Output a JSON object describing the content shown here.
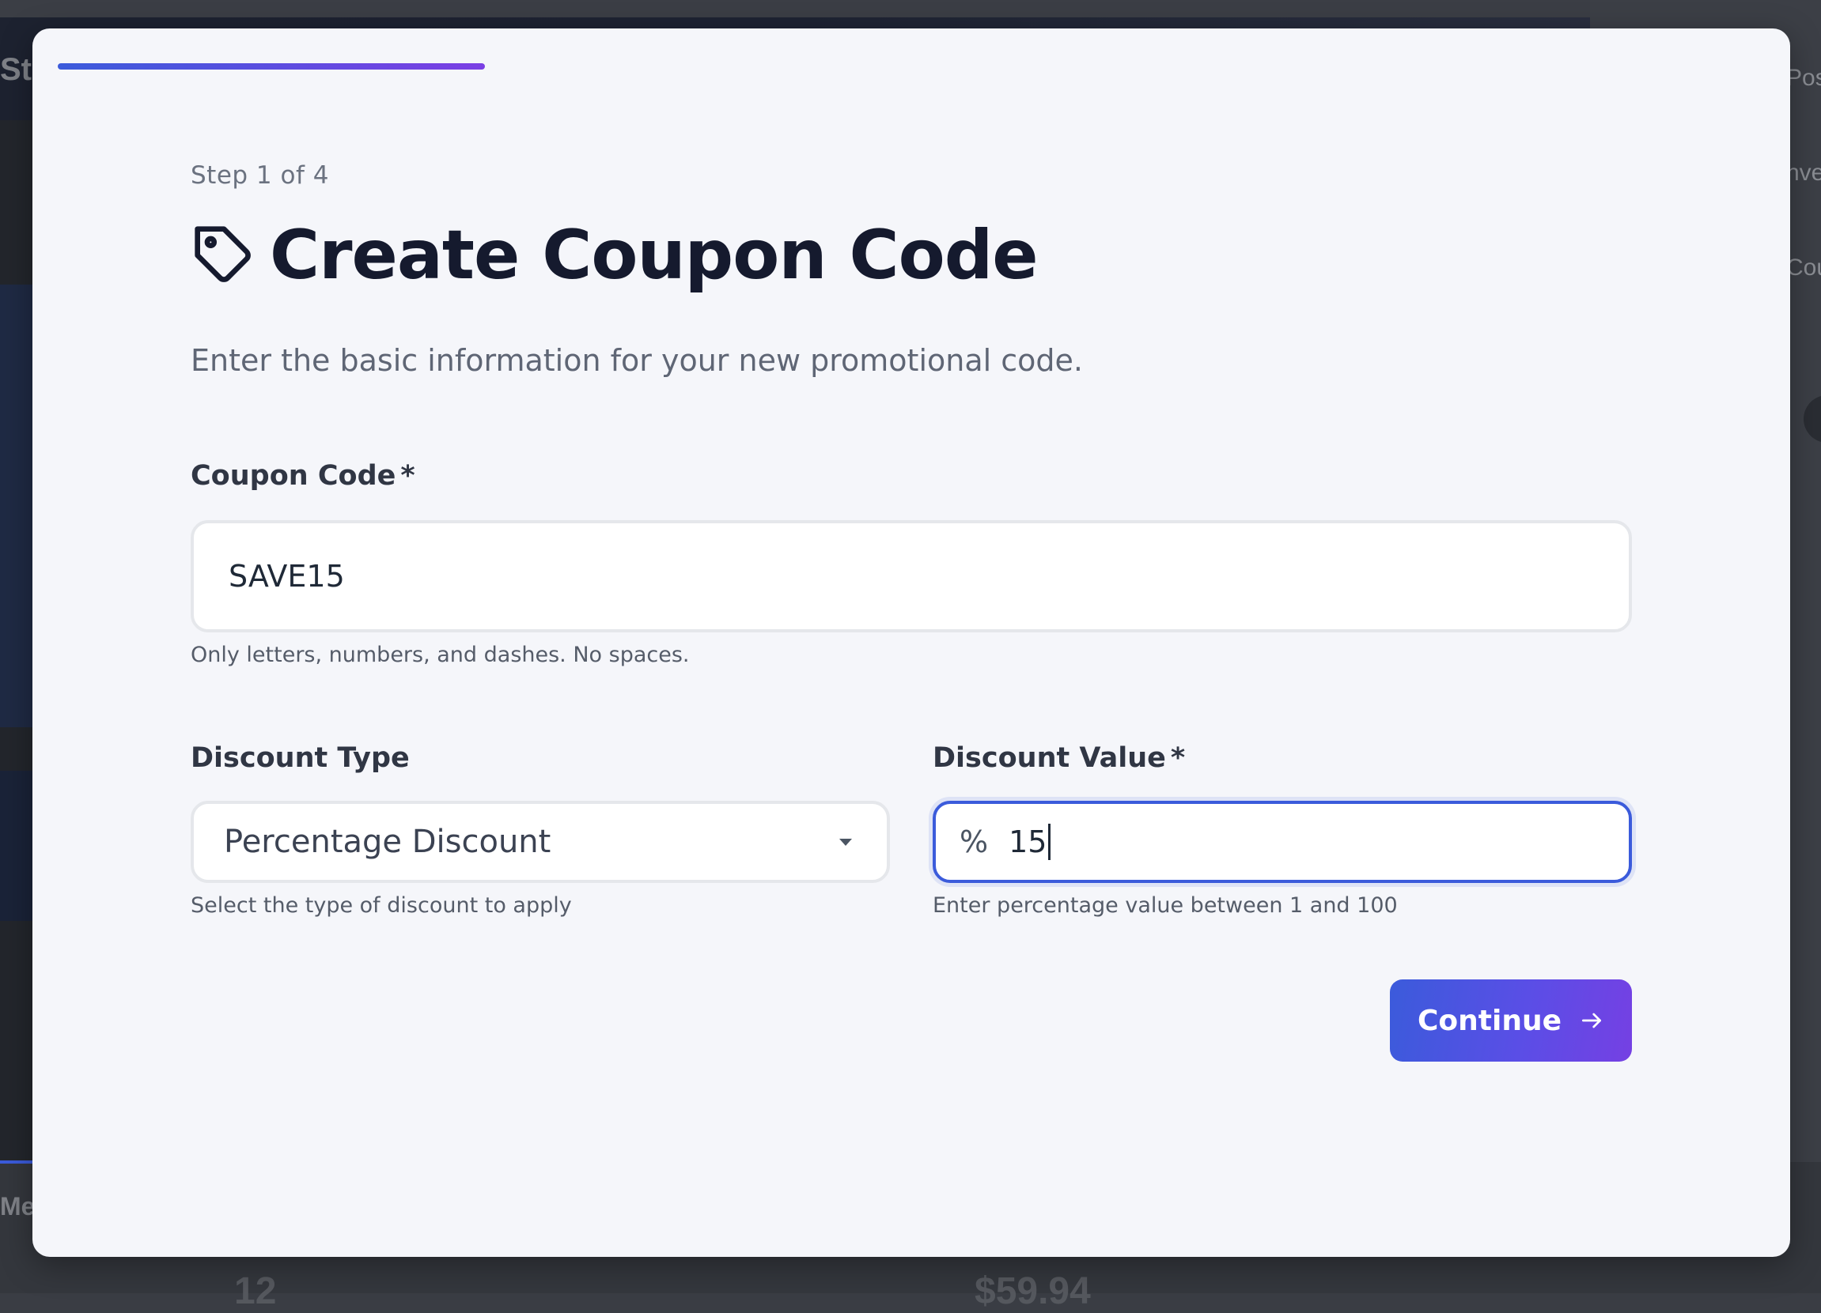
{
  "wizard": {
    "progress_fraction": 0.25,
    "step_label": "Step 1 of 4",
    "title": "Create Coupon Code",
    "title_icon": "tag-icon",
    "subtitle": "Enter the basic information for your new promotional code."
  },
  "form": {
    "coupon_code": {
      "label": "Coupon Code",
      "required_mark": "*",
      "value": "SAVE15",
      "helper": "Only letters, numbers, and dashes. No spaces."
    },
    "discount_type": {
      "label": "Discount Type",
      "selected": "Percentage Discount",
      "helper": "Select the type of discount to apply"
    },
    "discount_value": {
      "label": "Discount Value",
      "required_mark": "*",
      "prefix": "%",
      "value": "15",
      "helper": "Enter percentage value between 1 and 100"
    }
  },
  "actions": {
    "continue_label": "Continue",
    "continue_icon": "arrow-right-icon"
  },
  "background": {
    "left_text_1": "Sto",
    "right_text_1": "Pos",
    "right_text_2": "nve",
    "right_text_3": "Cou",
    "bottom_left_text": "Mer",
    "bottom_num_1": "12",
    "bottom_num_2": "$59.94"
  },
  "colors": {
    "accent": "#3b5bdb",
    "accent_end": "#7540e3",
    "modal_bg": "#f5f6fa",
    "title": "#151a2e"
  }
}
